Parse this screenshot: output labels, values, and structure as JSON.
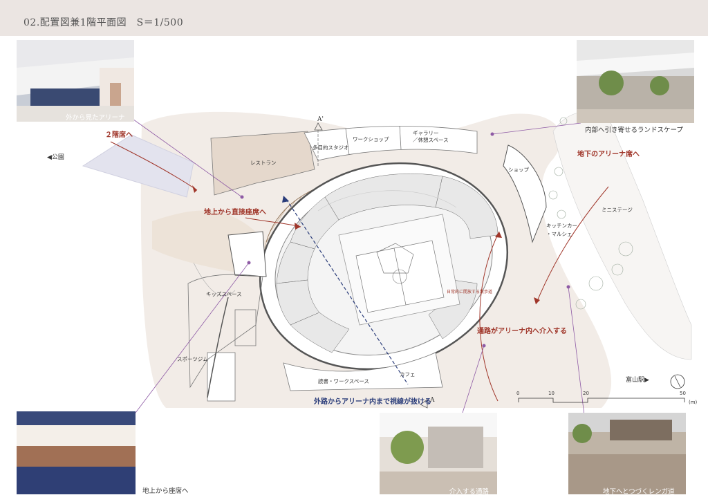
{
  "header": {
    "title": "02.配置図兼1階平面図　S＝1/500"
  },
  "photos": [
    {
      "id": "outside",
      "caption": "外から見たアリーナ"
    },
    {
      "id": "landscape",
      "caption": "内部へ引き寄せるランドスケープ"
    },
    {
      "id": "ground",
      "caption": "地上から座席へ"
    },
    {
      "id": "passage",
      "caption": "介入する通路"
    },
    {
      "id": "brick",
      "caption": "地下へとつづくレンガ道"
    }
  ],
  "annotations": {
    "second_floor": "２階席へ",
    "ground_direct": "地上から直接座席へ",
    "underground": "地下のアリーナ席へ",
    "road_intervene": "通路がアリーナ内へ介入する",
    "sightline": "外路からアリーナ内まで視線が抜ける",
    "daily_walk": "日常的に開放する散歩道"
  },
  "rooms": {
    "restaurant": "レストラン",
    "studio": "多目的スタジオ",
    "shop_top": "ワークショップ",
    "gallery": "ギャラリー\n／休憩スペース",
    "shop_right": "ショップ",
    "kitchen": "キッチンカー\n・マルシェ",
    "ministage": "ミニステージ",
    "kids": "キッズスペース",
    "gym": "スポーツジム",
    "reading": "読書・ワークスペース",
    "cafe": "カフェ",
    "park": "◀公園",
    "station": "富山駅▶"
  },
  "section_marks": {
    "a_prime": "A'",
    "a": "A"
  },
  "scale": {
    "ticks": [
      "0",
      "10",
      "20",
      "50"
    ],
    "unit": "(m)"
  },
  "colors": {
    "accent_red": "#a0362a",
    "accent_blue": "#2b3d7a",
    "leader": "#8e5aa5",
    "header_bg": "#ebe5e2"
  }
}
